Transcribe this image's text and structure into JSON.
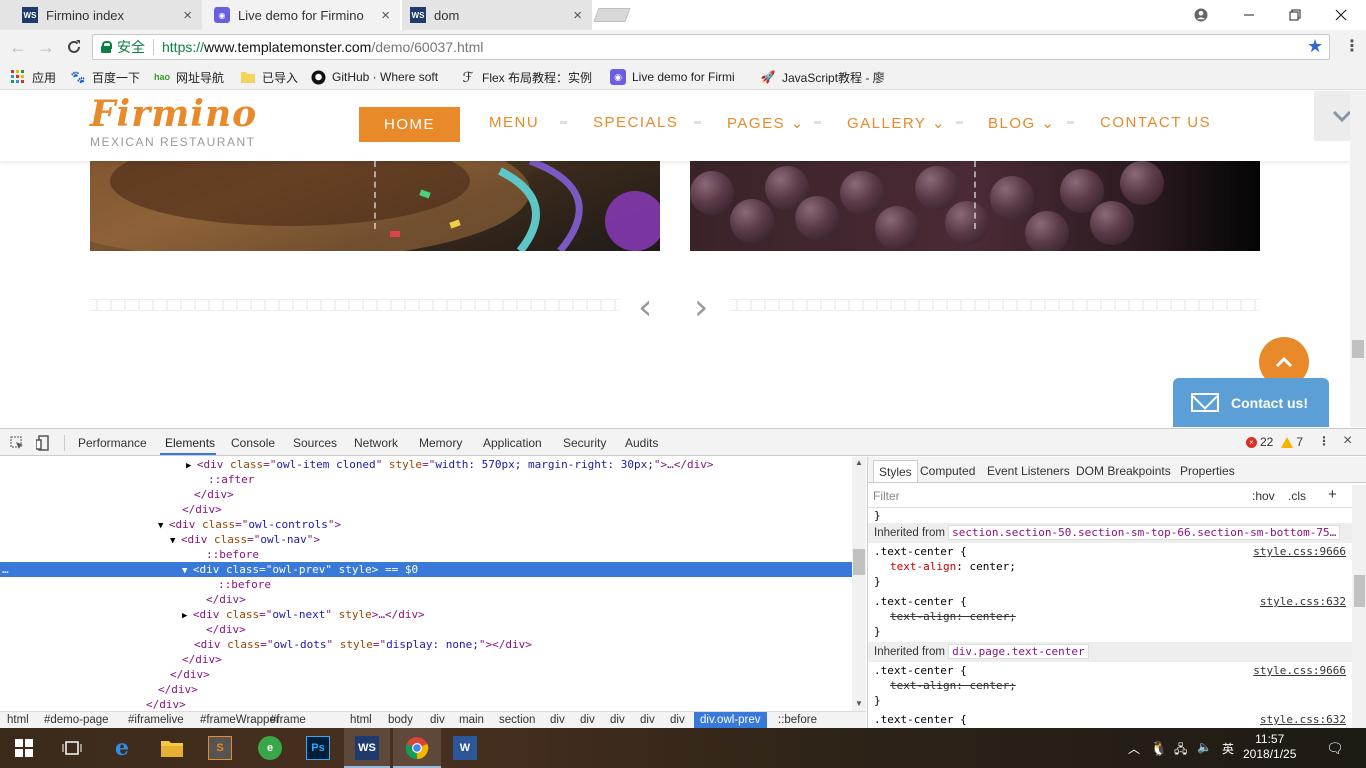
{
  "browser": {
    "tabs": [
      {
        "title": "Firmino index",
        "favicon": "ws-icon",
        "state": "inactive"
      },
      {
        "title": "Live demo for Firmino",
        "favicon": "templatemonster-icon",
        "state": "active"
      },
      {
        "title": "dom",
        "favicon": "ws-icon",
        "state": "inactive"
      }
    ],
    "close_glyph": "×",
    "address": {
      "security_label": "安全",
      "url_scheme": "https://",
      "url_host": "www.templatemonster.com",
      "url_path": "/demo/60037.html"
    },
    "bookmarks": [
      {
        "label": "应用",
        "icon": "apps-grid-icon"
      },
      {
        "label": "百度一下",
        "icon": "baidu-paw-icon"
      },
      {
        "label": "网址导航",
        "icon": "hao123-icon"
      },
      {
        "label": "已导入",
        "icon": "folder-icon"
      },
      {
        "label": "GitHub · Where soft",
        "icon": "github-icon"
      },
      {
        "label": "Flex 布局教程：实例",
        "icon": "feather-icon"
      },
      {
        "label": "Live demo for Firmi",
        "icon": "templatemonster-icon"
      },
      {
        "label": "JavaScript教程 - 廖",
        "icon": "rocket-icon"
      }
    ]
  },
  "site": {
    "logo": "Firmino",
    "tagline": "MEXICAN RESTAURANT",
    "menu": {
      "home": "HOME",
      "menu": "MENU",
      "specials": "SPECIALS",
      "pages": "PAGES",
      "gallery": "GALLERY",
      "blog": "BLOG",
      "contact": "CONTACT US"
    },
    "caret": "⌄",
    "prev_arrow": "‹",
    "next_arrow": "›",
    "to_top": "⌃",
    "contact_label": "Contact us!",
    "accent_color": "#e8892a"
  },
  "devtools": {
    "tabs": [
      "Performance",
      "Elements",
      "Console",
      "Sources",
      "Network",
      "Memory",
      "Application",
      "Security",
      "Audits"
    ],
    "active_tab": "Elements",
    "errors": "22",
    "warnings": "7",
    "dom_lines": [
      {
        "arrow": "▶",
        "tag_open": "<div ",
        "attrs": [
          [
            "class",
            "owl-item cloned"
          ],
          [
            "style",
            "width: 570px; margin-right: 30px;"
          ]
        ],
        "tail": ">…</div>"
      },
      {
        "pseudo": "::after"
      },
      {
        "close": "</div>"
      },
      {
        "close": "</div>"
      },
      {
        "arrow": "▼",
        "tag_open": "<div ",
        "attrs": [
          [
            "class",
            "owl-controls"
          ]
        ],
        "tail": ">"
      },
      {
        "arrow": "▼",
        "tag_open": "<div ",
        "attrs": [
          [
            "class",
            "owl-nav"
          ]
        ],
        "tail": ">"
      },
      {
        "pseudo": "::before"
      },
      {
        "arrow": "▼",
        "tag_open": "<div ",
        "attrs": [
          [
            "class",
            "owl-prev"
          ]
        ],
        "bare_attr": " style",
        "tail": "> == $0"
      },
      {
        "pseudo": "::before"
      },
      {
        "close": "</div>"
      },
      {
        "arrow": "▶",
        "tag_open": "<div ",
        "attrs": [
          [
            "class",
            "owl-next"
          ]
        ],
        "bare_attr": " style",
        "tail": ">…</div>"
      },
      {
        "close": "</div>"
      },
      {
        "tag_open": "<div ",
        "attrs": [
          [
            "class",
            "owl-dots"
          ],
          [
            "style",
            "display: none;"
          ]
        ],
        "tail": "></div>"
      },
      {
        "close": "</div>"
      },
      {
        "close": "</div>"
      },
      {
        "close": "</div>"
      },
      {
        "close": "</div>"
      }
    ],
    "breadcrumbs": [
      "html",
      "#demo-page",
      "#iframelive",
      "#frameWrapper",
      "#frame",
      "html",
      "body",
      "div",
      "main",
      "section",
      "div",
      "div",
      "div",
      "div",
      "div",
      "div.owl-prev",
      "::before"
    ],
    "styles_tabs": [
      "Styles",
      "Computed",
      "Event Listeners",
      "DOM Breakpoints",
      "Properties"
    ],
    "filter_placeholder": "Filter",
    "hov": ":hov",
    "cls": ".cls",
    "plus": "+",
    "rules": {
      "inherited_1_label": "Inherited from",
      "inherited_1_selector": "section.section-50.section-sm-top-66.section-sm-bottom-75…",
      "inherited_2_label": "Inherited from",
      "inherited_2_selector": "div.page.text-center",
      "selector": ".text-center {",
      "property": "text-align",
      "value": "center;",
      "source_a": "style.css:9666",
      "source_b": "style.css:632"
    }
  },
  "taskbar": {
    "time": "11:57",
    "date": "2018/1/25",
    "ime": "英"
  }
}
